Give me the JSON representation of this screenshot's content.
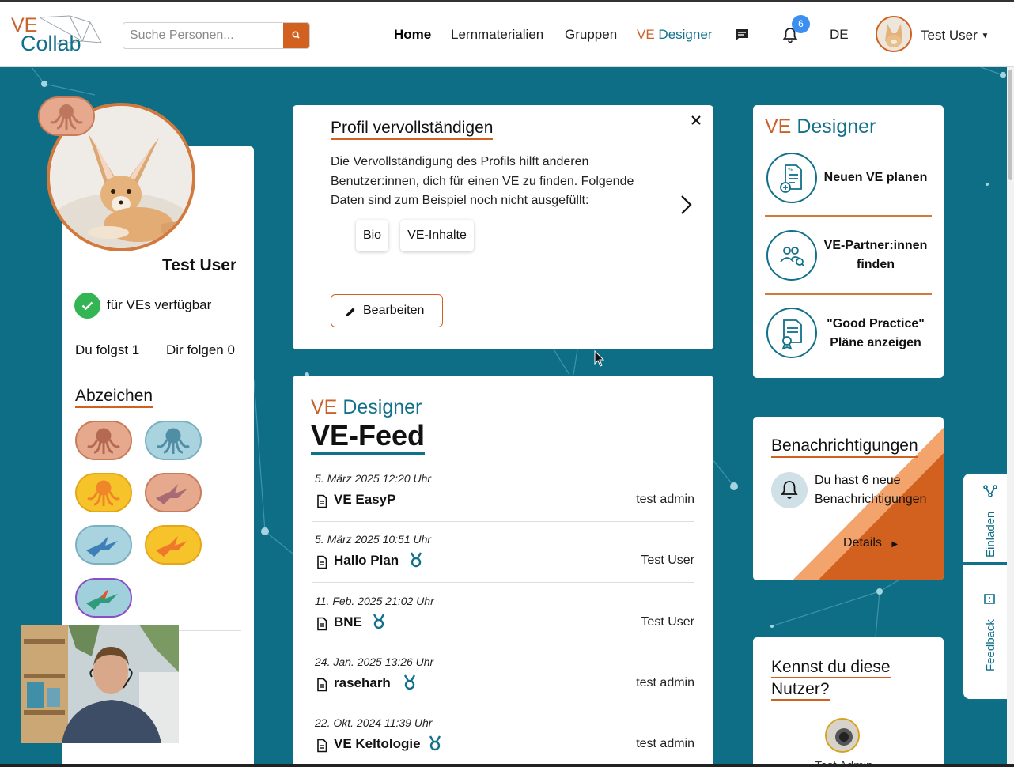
{
  "header": {
    "logo_ve": "VE",
    "logo_collab": "Collab",
    "search_placeholder": "Suche Personen...",
    "nav": {
      "home": "Home",
      "lernmaterialien": "Lernmaterialien",
      "gruppen": "Gruppen",
      "ve_designer_ve": "VE",
      "ve_designer_rest": "Designer"
    },
    "notification_count": "6",
    "language": "DE",
    "user_name": "Test User"
  },
  "profile": {
    "name": "Test User",
    "availability": "für VEs verfügbar",
    "following": "Du folgst 1",
    "followers": "Dir folgen 0",
    "badges_title": "Abzeichen"
  },
  "profile_completion": {
    "title": "Profil vervollständigen",
    "text": "Die Vervollständigung des Profils hilft anderen Benutzer:innen, dich für einen VE zu finden. Folgende Daten sind zum Beispiel noch nicht ausgefüllt:",
    "chips": [
      "Bio",
      "VE-Inhalte"
    ],
    "edit_label": "Bearbeiten"
  },
  "feed": {
    "sub_ve": "VE",
    "sub_designer": "Designer",
    "title": "VE-Feed",
    "items": [
      {
        "date": "5. März 2025 12:20 Uhr",
        "title": "VE EasyP",
        "author": "test admin",
        "medal": false
      },
      {
        "date": "5. März 2025 10:51 Uhr",
        "title": "Hallo Plan",
        "author": "Test User",
        "medal": true
      },
      {
        "date": "11. Feb. 2025 21:02 Uhr",
        "title": "BNE",
        "author": "Test User",
        "medal": true
      },
      {
        "date": "24. Jan. 2025 13:26 Uhr",
        "title": "raseharh",
        "author": "test admin",
        "medal": true
      },
      {
        "date": "22. Okt. 2024 11:39 Uhr",
        "title": "VE Keltologie",
        "author": "test admin",
        "medal": true
      }
    ]
  },
  "ve_designer": {
    "title_ve": "VE",
    "title_designer": "Designer",
    "actions": [
      {
        "label": "Neuen VE planen",
        "icon": "document-plus-icon"
      },
      {
        "label": "VE-Partner:innen finden",
        "icon": "people-search-icon"
      },
      {
        "label": "\"Good Practice\" Pläne anzeigen",
        "icon": "certificate-icon"
      }
    ]
  },
  "notifications": {
    "title": "Benachrichtigungen",
    "text": "Du hast 6 neue Benachrichtigungen",
    "details": "Details"
  },
  "suggestions": {
    "title": "Kennst du diese Nutzer?",
    "user": "Test Admin"
  },
  "side_tabs": {
    "invite": "Einladen",
    "feedback": "Feedback"
  },
  "colors": {
    "brand_orange": "#d2611f",
    "brand_teal": "#11708a",
    "background": "#0d6e86"
  }
}
